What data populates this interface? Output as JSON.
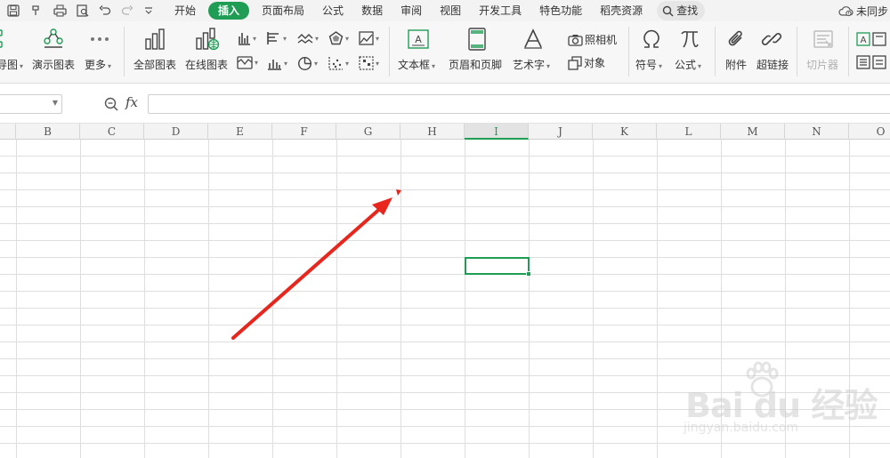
{
  "menu": {
    "tabs": [
      "开始",
      "插入",
      "页面布局",
      "公式",
      "数据",
      "审阅",
      "视图",
      "开发工具",
      "特色功能",
      "稻壳资源"
    ],
    "active_tab": "插入",
    "search_label": "查找",
    "cloud_label": "未同步"
  },
  "ribbon": {
    "flow_chart_partial": "导图",
    "demo_chart": "演示图表",
    "more": "更多",
    "all_charts": "全部图表",
    "online_charts": "在线图表",
    "textbox": "文本框",
    "header_footer": "页眉和页脚",
    "wordart": "艺术字",
    "camera": "照相机",
    "object": "对象",
    "symbol": "符号",
    "formula": "公式",
    "attachment": "附件",
    "hyperlink": "超链接",
    "slicer": "切片器"
  },
  "formula_bar": {
    "name_box_value": "",
    "fx_label": "fx",
    "formula_value": ""
  },
  "grid": {
    "columns": [
      "B",
      "C",
      "D",
      "E",
      "F",
      "G",
      "H",
      "I",
      "J",
      "K",
      "L",
      "M",
      "N",
      "O"
    ],
    "selected_column": "I",
    "cells": []
  },
  "watermark": {
    "brand_text": "Bai du 经验",
    "url_text": "jingyan.baidu.com"
  },
  "colors": {
    "accent": "#1f9d55",
    "arrow": "#e8261d"
  }
}
